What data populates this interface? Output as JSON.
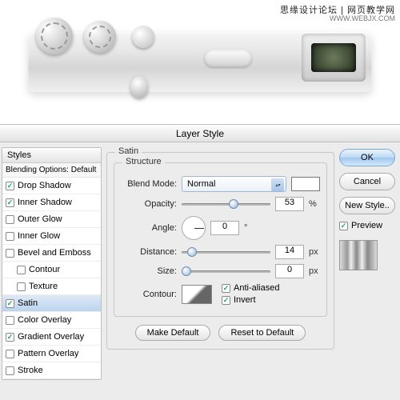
{
  "banner": {
    "watermark": "思缘设计论坛 | 网页教学网",
    "url": "WWW.WEBJX.COM"
  },
  "dialog": {
    "title": "Layer Style",
    "styles_header": "Styles",
    "blending_default": "Blending Options: Default",
    "items": [
      {
        "label": "Drop Shadow",
        "checked": true
      },
      {
        "label": "Inner Shadow",
        "checked": true
      },
      {
        "label": "Outer Glow",
        "checked": false
      },
      {
        "label": "Inner Glow",
        "checked": false
      },
      {
        "label": "Bevel and Emboss",
        "checked": false
      },
      {
        "label": "Contour",
        "checked": false,
        "indent": true
      },
      {
        "label": "Texture",
        "checked": false,
        "indent": true
      },
      {
        "label": "Satin",
        "checked": true,
        "selected": true
      },
      {
        "label": "Color Overlay",
        "checked": false
      },
      {
        "label": "Gradient Overlay",
        "checked": true
      },
      {
        "label": "Pattern Overlay",
        "checked": false
      },
      {
        "label": "Stroke",
        "checked": false
      }
    ],
    "group_label": "Satin",
    "structure_label": "Structure",
    "labels": {
      "blend_mode": "Blend Mode:",
      "opacity": "Opacity:",
      "angle": "Angle:",
      "distance": "Distance:",
      "size": "Size:",
      "contour": "Contour:",
      "anti_aliased": "Anti-aliased",
      "invert": "Invert"
    },
    "values": {
      "blend_mode": "Normal",
      "opacity": "53",
      "opacity_unit": "%",
      "angle": "0",
      "angle_unit": "°",
      "distance": "14",
      "distance_unit": "px",
      "size": "0",
      "size_unit": "px"
    },
    "buttons": {
      "make_default": "Make Default",
      "reset_default": "Reset to Default",
      "ok": "OK",
      "cancel": "Cancel",
      "new_style": "New Style..",
      "preview": "Preview"
    }
  }
}
